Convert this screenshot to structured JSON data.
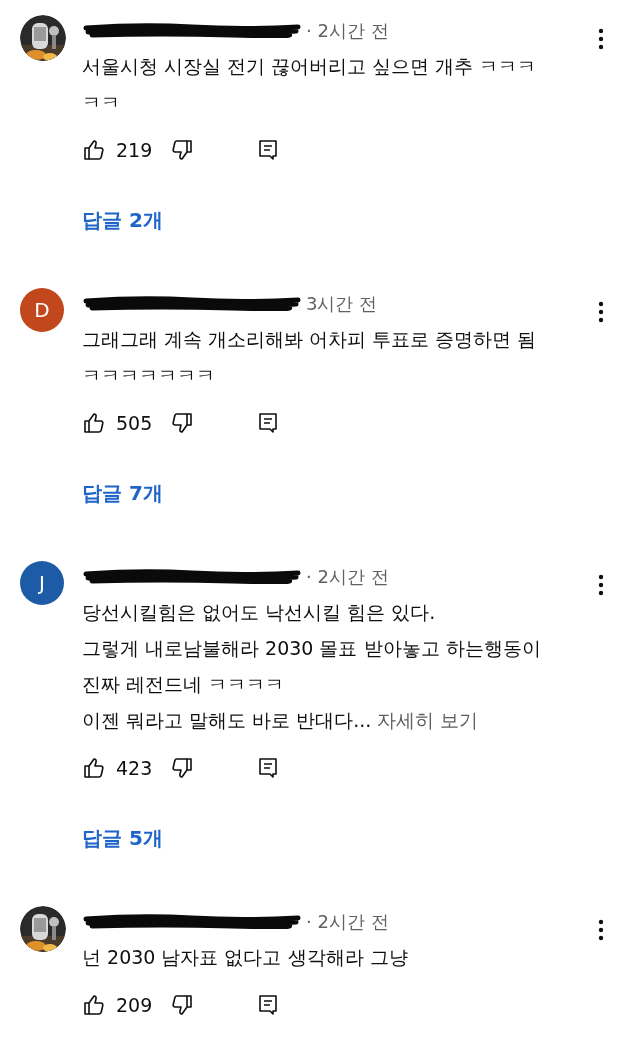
{
  "comments": [
    {
      "time": "· 2시간 전",
      "body": "서울시청 시장실 전기 끊어버리고 싶으면 개추 ㅋㅋㅋㅋㅋ",
      "likes": "219",
      "replies": "답글 2개"
    },
    {
      "avatar": {
        "kind": "letter",
        "letter": "D",
        "color": "#c2471c"
      },
      "time": "3시간 전",
      "body": "그래그래 계속 개소리해봐 어차피 투표로 증명하면 됨 ㅋㅋㅋㅋㅋㅋㅋ",
      "likes": "505",
      "replies": "답글 7개"
    },
    {
      "avatar": {
        "kind": "letter",
        "letter": "J",
        "color": "#1d5ba6"
      },
      "time": "· 2시간 전",
      "body": "당선시킬힘은 없어도 낙선시킬 힘은 있다.\n그렇게 내로남불해라 2030 몰표 받아놓고 하는행동이\n진짜 레전드네 ㅋㅋㅋㅋ\n이젠 뭐라고 말해도 바로 반대다...",
      "more_link": "자세히 보기",
      "likes": "423",
      "replies": "답글 5개"
    },
    {
      "time": "· 2시간 전",
      "body": "넌 2030 남자표 없다고 생각해라 그냥",
      "likes": "209"
    }
  ]
}
